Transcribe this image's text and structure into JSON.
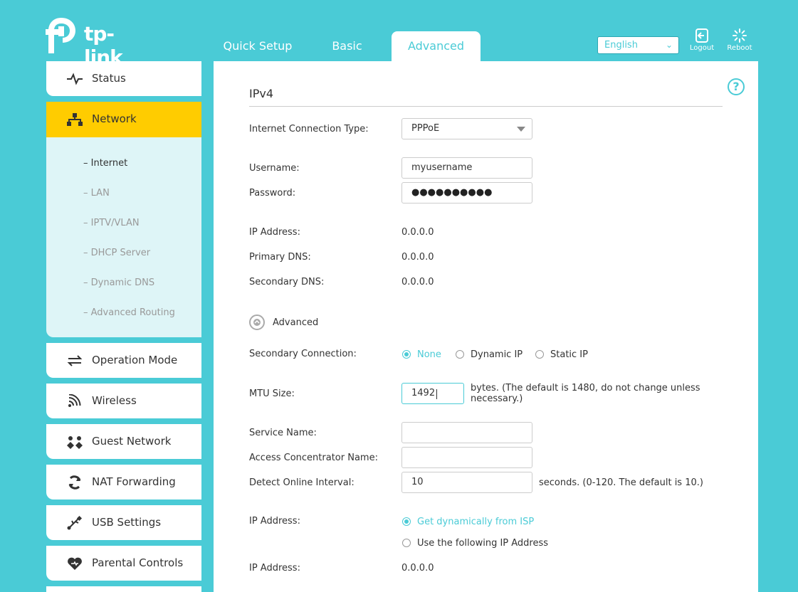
{
  "brand": {
    "name": "tp-link"
  },
  "tabs": [
    {
      "label": "Quick Setup"
    },
    {
      "label": "Basic"
    },
    {
      "label": "Advanced"
    }
  ],
  "header": {
    "language": "English",
    "logout_label": "Logout",
    "reboot_label": "Reboot"
  },
  "sidebar": {
    "items": [
      {
        "label": "Status",
        "icon": "pulse-icon"
      },
      {
        "label": "Network",
        "icon": "network-icon"
      },
      {
        "label": "Operation Mode",
        "icon": "mode-icon"
      },
      {
        "label": "Wireless",
        "icon": "wireless-icon"
      },
      {
        "label": "Guest Network",
        "icon": "guest-icon"
      },
      {
        "label": "NAT Forwarding",
        "icon": "nat-icon"
      },
      {
        "label": "USB Settings",
        "icon": "usb-icon"
      },
      {
        "label": "Parental Controls",
        "icon": "heart-icon"
      }
    ],
    "network_sub": [
      {
        "label": "Internet"
      },
      {
        "label": "LAN"
      },
      {
        "label": "IPTV/VLAN"
      },
      {
        "label": "DHCP Server"
      },
      {
        "label": "Dynamic DNS"
      },
      {
        "label": "Advanced Routing"
      }
    ]
  },
  "form": {
    "section_title": "IPv4",
    "connection_type_label": "Internet Connection Type:",
    "connection_type_value": "PPPoE",
    "username_label": "Username:",
    "username_value": "myusername",
    "password_label": "Password:",
    "password_mask": "●●●●●●●●●●",
    "ip_label": "IP Address:",
    "ip_value": "0.0.0.0",
    "primary_dns_label": "Primary DNS:",
    "primary_dns_value": "0.0.0.0",
    "secondary_dns_label": "Secondary DNS:",
    "secondary_dns_value": "0.0.0.0",
    "advanced_label": "Advanced",
    "secondary_conn_label": "Secondary Connection:",
    "secondary_conn_options": [
      "None",
      "Dynamic IP",
      "Static IP"
    ],
    "mtu_label": "MTU Size:",
    "mtu_value": "1492",
    "mtu_note_1": "bytes. (The default is 1480, do not change unless",
    "mtu_note_2": "necessary.)",
    "service_name_label": "Service Name:",
    "service_name_value": "",
    "ac_name_label": "Access Concentrator Name:",
    "ac_name_value": "",
    "detect_label": "Detect Online Interval:",
    "detect_value": "10",
    "detect_note": "seconds. (0-120. The default is 10.)",
    "ip_mode_label": "IP Address:",
    "ip_mode_options": [
      "Get dynamically from ISP",
      "Use the following IP Address"
    ],
    "ip2_label": "IP Address:",
    "ip2_value": "0.0.0.0"
  },
  "colors": {
    "accent": "#4acbd6",
    "active_nav": "#ffcc00"
  }
}
